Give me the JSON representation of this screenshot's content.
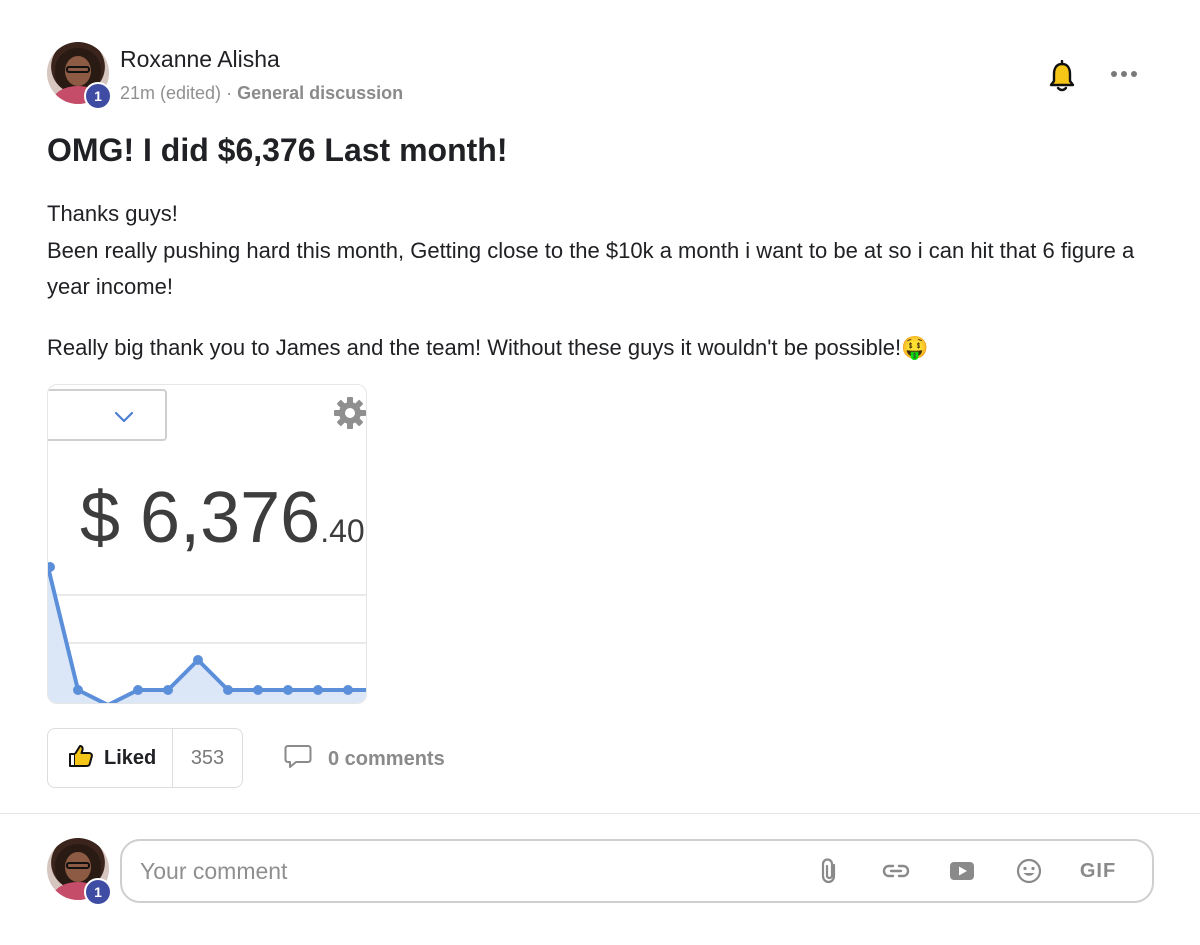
{
  "post": {
    "author": {
      "name": "Roxanne Alisha",
      "level": "1"
    },
    "meta": {
      "time": "21m (edited)",
      "separator": "·",
      "category": "General discussion"
    },
    "title": "OMG! I did $6,376 Last month!",
    "body": {
      "line1": "Thanks guys!",
      "line2": "Been really pushing hard this month, Getting close to the $10k a month i want to be at so i can hit that 6 figure a year income!",
      "line3": "Really big thank you to James and the team! Without these guys it wouldn't be possible!🤑"
    },
    "attachment": {
      "amount_main": "$ 6,376",
      "amount_cents": ".40",
      "chart_color": "#5b8fd9"
    },
    "actions": {
      "like_label": "Liked",
      "like_count": "353",
      "comments_label": "0 comments"
    }
  },
  "composer": {
    "level": "1",
    "placeholder": "Your comment",
    "gif_label": "GIF"
  },
  "icons": {
    "bell": "bell-icon",
    "more": "more-horizontal-icon",
    "like": "thumbs-up-icon",
    "comment": "comment-bubble-icon",
    "attach": "paperclip-icon",
    "link": "link-icon",
    "video": "video-play-icon",
    "emoji": "emoji-smile-icon"
  },
  "colors": {
    "badge": "#3f4ca4",
    "text": "#202124",
    "muted": "#8a8a8a"
  }
}
